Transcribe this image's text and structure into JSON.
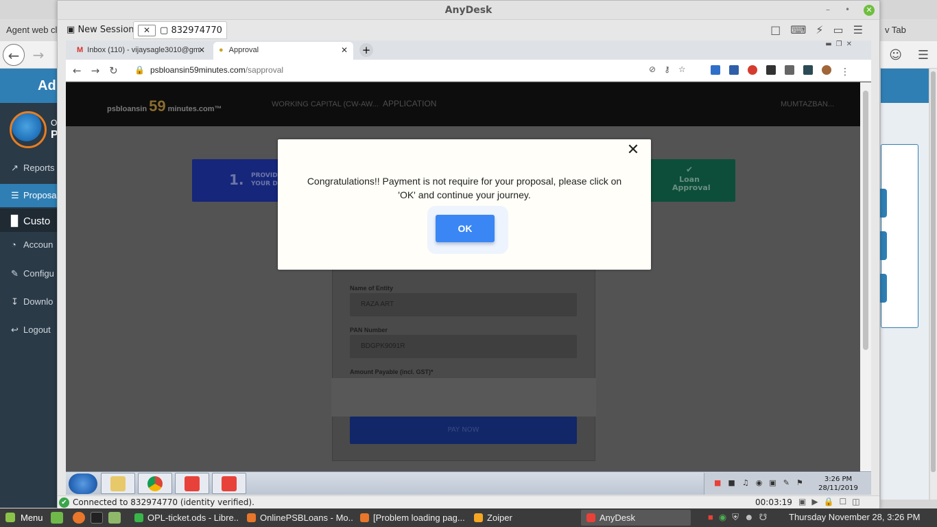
{
  "local": {
    "bg_tab_left": "Agent web cli",
    "bg_tab_right": "v Tab",
    "sidebar_header": "Ad",
    "logo_text_1": "O",
    "logo_text_2": "P",
    "sidebar_items": [
      {
        "label": "Reports",
        "icon": "chart-line-icon"
      },
      {
        "label": "Proposa",
        "icon": "database-icon"
      },
      {
        "label": "Custo",
        "icon": "bar-chart-icon"
      },
      {
        "label": "Accoun",
        "icon": "pie-chart-icon"
      },
      {
        "label": "Configu",
        "icon": "edit-icon"
      },
      {
        "label": "Downlo",
        "icon": "download-icon"
      },
      {
        "label": "Logout",
        "icon": "logout-icon"
      }
    ]
  },
  "anydesk": {
    "title": "AnyDesk",
    "tab_new": "New Session",
    "tab_session": "832974770",
    "status_msg": "Connected to 832974770 (identity verified).",
    "timer": "00:03:19"
  },
  "remote": {
    "tab1": "Inbox (110) - vijaysagle3010@gm",
    "tab2": "Approval",
    "url_host": "psbloansin59minutes.com",
    "url_path": "/sapproval",
    "brand_pre": "psbloansin",
    "brand_num": "59",
    "brand_post": "minutes.com™",
    "nav_working_capital": "WORKING CAPITAL (CW-AW...",
    "nav_application": "APPLICATION",
    "nav_user": "MUMTAZBAN...",
    "step1_num": "1.",
    "step1_text_1": "PROVIDE",
    "step1_text_2": "YOUR D",
    "step_last_text": "Loan Approval",
    "form": {
      "entity_label": "Name of Entity",
      "entity_value": "RAZA ART",
      "pan_label": "PAN Number",
      "pan_value": "BDGPK9091R",
      "amount_label": "Amount Payable (incl. GST)*",
      "submit_label": "PAY NOW"
    },
    "modal": {
      "message": "Congratulations!! Payment is not require for your proposal, please click on 'OK' and continue your journey.",
      "ok_label": "OK"
    },
    "clock_time": "3:26 PM",
    "clock_date": "28/11/2019"
  },
  "panel": {
    "menu_label": "Menu",
    "tasks": [
      {
        "label": "OPL-ticket.ods - Libre...",
        "color": "#3ab54a"
      },
      {
        "label": "OnlinePSBLoans - Mo...",
        "color": "#e8762b"
      },
      {
        "label": "[Problem loading pag...",
        "color": "#e8762b"
      },
      {
        "label": "Zoiper",
        "color": "#f5a623"
      },
      {
        "label": "AnyDesk",
        "color": "#e8413a"
      }
    ],
    "clock": "Thursday November 28,  3:26 PM"
  },
  "colors": {
    "accent_blue": "#2f7fb5",
    "ok_button": "#3a86f5",
    "anydesk_red": "#e8413a"
  }
}
